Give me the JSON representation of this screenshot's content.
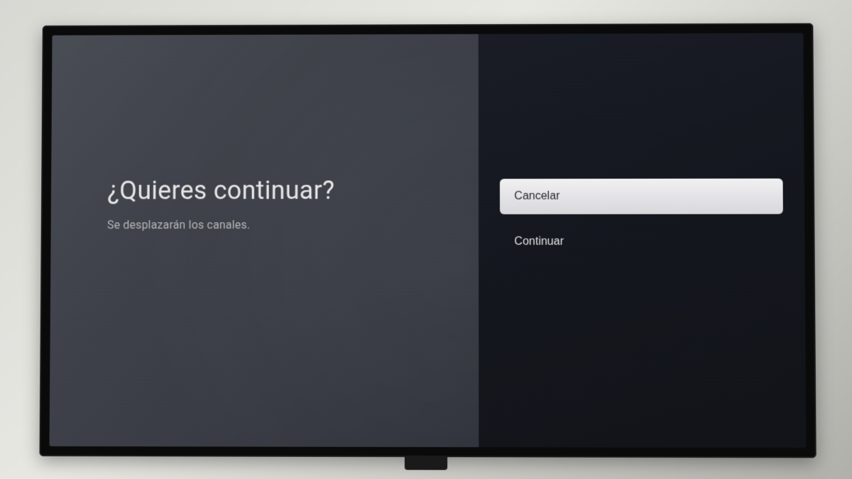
{
  "dialog": {
    "title": "¿Quieres continuar?",
    "subtitle": "Se desplazarán los canales."
  },
  "options": {
    "cancel": "Cancelar",
    "continue": "Continuar"
  }
}
